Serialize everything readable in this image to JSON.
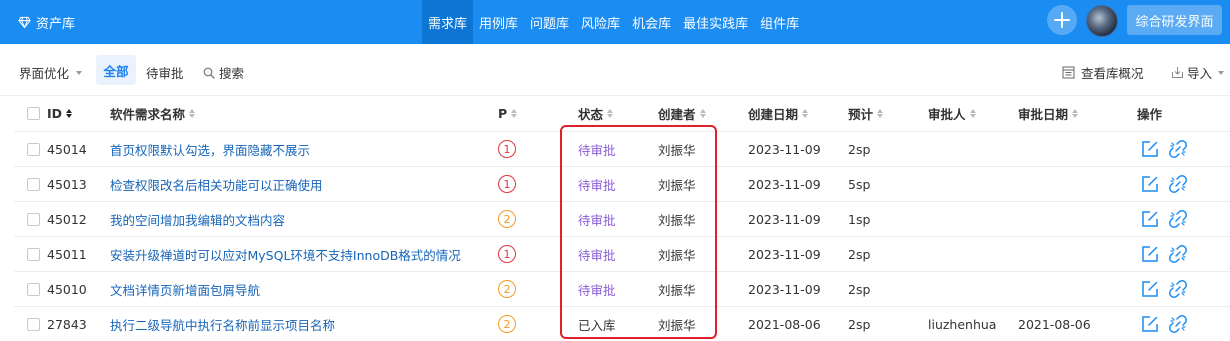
{
  "app": {
    "brand": "资产库"
  },
  "nav": [
    {
      "label": "需求库",
      "active": true
    },
    {
      "label": "用例库",
      "active": false
    },
    {
      "label": "问题库",
      "active": false
    },
    {
      "label": "风险库",
      "active": false
    },
    {
      "label": "机会库",
      "active": false
    },
    {
      "label": "最佳实践库",
      "active": false
    },
    {
      "label": "组件库",
      "active": false
    }
  ],
  "header_right": {
    "workspace": "综合研发界面"
  },
  "toolbar": {
    "view": "界面优化",
    "filter_all": "全部",
    "filter_pending": "待审批",
    "search": "搜索",
    "overview": "查看库概况",
    "import": "导入"
  },
  "table": {
    "columns": {
      "id": "ID",
      "name": "软件需求名称",
      "priority": "P",
      "status": "状态",
      "creator": "创建者",
      "created": "创建日期",
      "estimate": "预计",
      "approver": "审批人",
      "approved": "审批日期",
      "actions": "操作"
    },
    "rows": [
      {
        "id": "45014",
        "name": "首页权限默认勾选，界面隐藏不展示",
        "priority": "1",
        "status": "待审批",
        "creator": "刘振华",
        "created": "2023-11-09",
        "estimate": "2sp",
        "approver": "",
        "approved": ""
      },
      {
        "id": "45013",
        "name": "检查权限改名后相关功能可以正确使用",
        "priority": "1",
        "status": "待审批",
        "creator": "刘振华",
        "created": "2023-11-09",
        "estimate": "5sp",
        "approver": "",
        "approved": ""
      },
      {
        "id": "45012",
        "name": "我的空间增加我编辑的文档内容",
        "priority": "2",
        "status": "待审批",
        "creator": "刘振华",
        "created": "2023-11-09",
        "estimate": "1sp",
        "approver": "",
        "approved": ""
      },
      {
        "id": "45011",
        "name": "安装升级禅道时可以应对MySQL环境不支持InnoDB格式的情况",
        "priority": "1",
        "status": "待审批",
        "creator": "刘振华",
        "created": "2023-11-09",
        "estimate": "2sp",
        "approver": "",
        "approved": ""
      },
      {
        "id": "45010",
        "name": "文档详情页新增面包屑导航",
        "priority": "2",
        "status": "待审批",
        "creator": "刘振华",
        "created": "2023-11-09",
        "estimate": "2sp",
        "approver": "",
        "approved": ""
      },
      {
        "id": "27843",
        "name": "执行二级导航中执行名称前显示项目名称",
        "priority": "2",
        "status": "已入库",
        "creator": "刘振华",
        "created": "2021-08-06",
        "estimate": "2sp",
        "approver": "liuzhenhua",
        "approved": "2021-08-06"
      }
    ]
  },
  "colors": {
    "accent": "#1a8cf2",
    "priority_1": "#e0353b",
    "priority_2": "#f59a23",
    "status_pending": "#8a5cd6",
    "highlight": "#e0202a"
  }
}
